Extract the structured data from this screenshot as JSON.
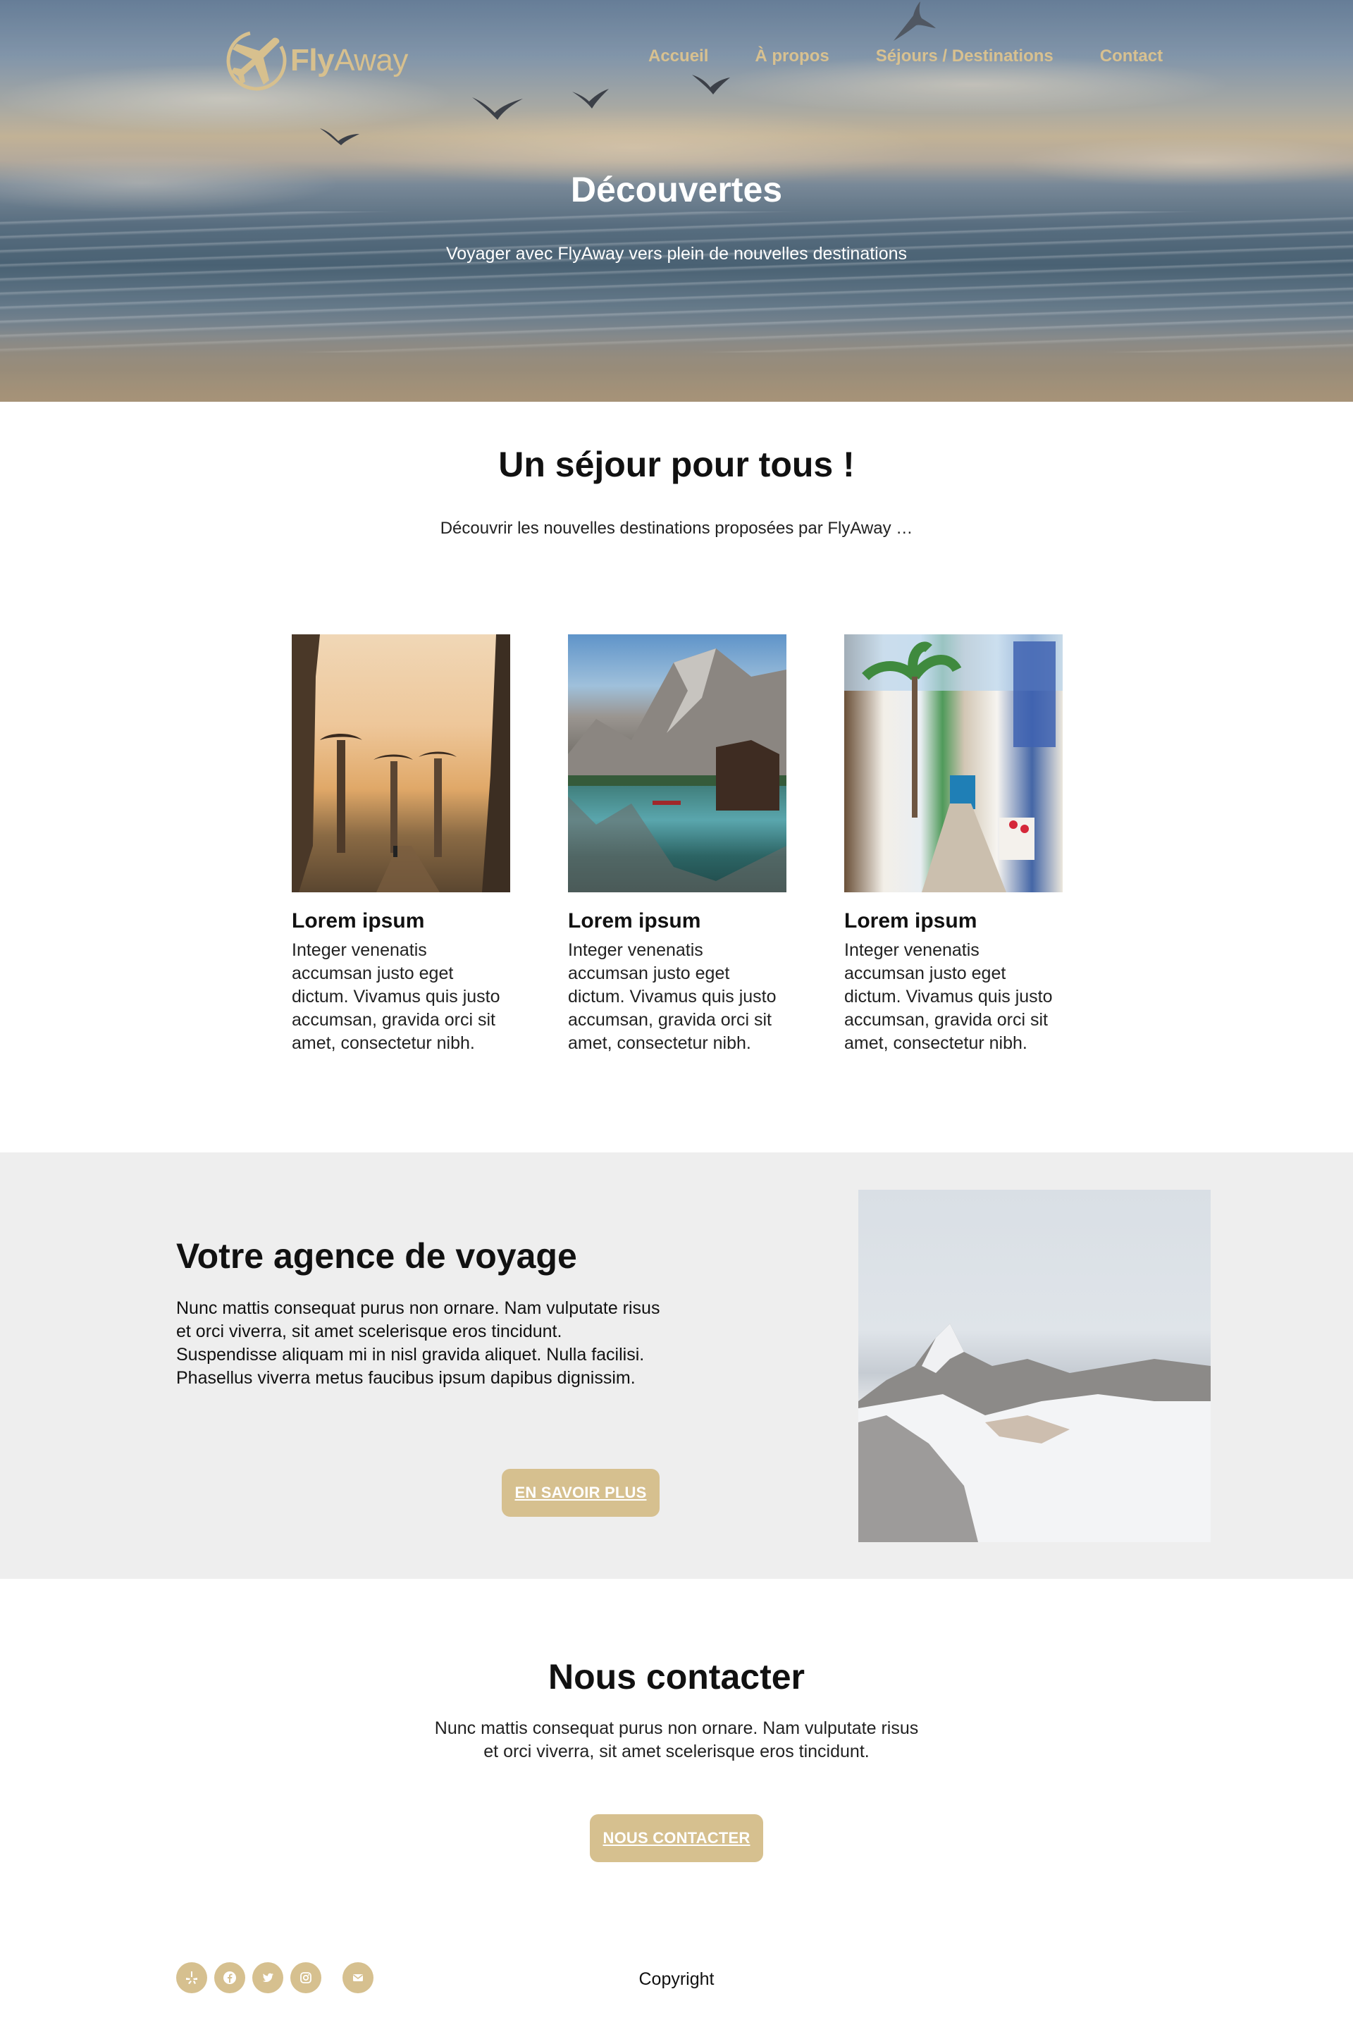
{
  "brand": {
    "name_bold": "Fly",
    "name_light": "Away",
    "color": "#d6c08f"
  },
  "nav": {
    "items": [
      "Accueil",
      "À propos",
      "Séjours / Destinations",
      "Contact"
    ]
  },
  "hero": {
    "title": "Découvertes",
    "subtitle": "Voyager avec FlyAway vers plein de nouvelles destinations"
  },
  "sejour": {
    "title": "Un séjour pour tous !",
    "subtitle": "Découvrir les nouvelles destinations proposées par FlyAway …",
    "cards": [
      {
        "title": "Lorem ipsum",
        "text": "Integer venenatis accumsan justo eget dictum. Vivamus quis justo accumsan, gravida orci sit amet, consectetur nibh.",
        "image": "baobab-avenue"
      },
      {
        "title": "Lorem ipsum",
        "text": "Integer venenatis accumsan justo eget dictum. Vivamus quis justo accumsan, gravida orci sit amet, consectetur nibh.",
        "image": "mountain-lake"
      },
      {
        "title": "Lorem ipsum",
        "text": "Integer venenatis accumsan justo eget dictum. Vivamus quis justo accumsan, gravida orci sit amet, consectetur nibh.",
        "image": "mediterranean-street"
      }
    ]
  },
  "agence": {
    "title": "Votre agence de voyage",
    "text": "Nunc mattis consequat purus non ornare. Nam vulputate risus et orci viverra, sit amet scelerisque eros tincidunt. Suspendisse aliquam mi in nisl gravida aliquet. Nulla facilisi. Phasellus viverra metus faucibus ipsum dapibus dignissim.",
    "button": "EN SAVOIR PLUS",
    "image": "snowy-mountains"
  },
  "contact": {
    "title": "Nous contacter",
    "text": "Nunc mattis consequat purus non ornare. Nam vulputate risus et orci viverra, sit amet scelerisque eros tincidunt.",
    "button": "NOUS CONTACTER"
  },
  "footer": {
    "social_icons": [
      "yelp-icon",
      "facebook-icon",
      "twitter-icon",
      "instagram-icon",
      "mail-icon"
    ],
    "copyright": "Copyright"
  }
}
